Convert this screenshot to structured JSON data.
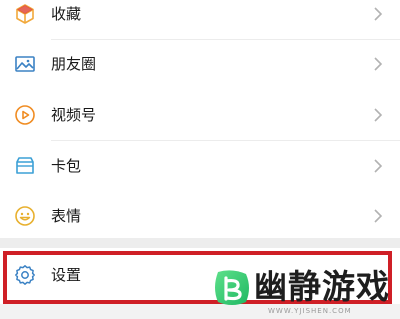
{
  "menu": {
    "items": [
      {
        "label": "收藏",
        "icon": "favorites-cube-icon",
        "color": "#f2a93b"
      },
      {
        "label": "朋友圈",
        "icon": "moments-photo-icon",
        "color": "#3b82c4"
      },
      {
        "label": "视频号",
        "icon": "channels-play-icon",
        "color": "#f08c22"
      },
      {
        "label": "卡包",
        "icon": "card-wallet-icon",
        "color": "#3ca0d6"
      },
      {
        "label": "表情",
        "icon": "sticker-smiley-icon",
        "color": "#e8b02e"
      }
    ],
    "settings": {
      "label": "设置",
      "icon": "gear-icon",
      "color": "#3b82c4"
    }
  },
  "highlight": {
    "color": "#cf1f26"
  },
  "watermark": {
    "name": "幽静游戏",
    "domain": "WWW.YJISHEN.COM",
    "logo_color": "#2ecf6f"
  }
}
